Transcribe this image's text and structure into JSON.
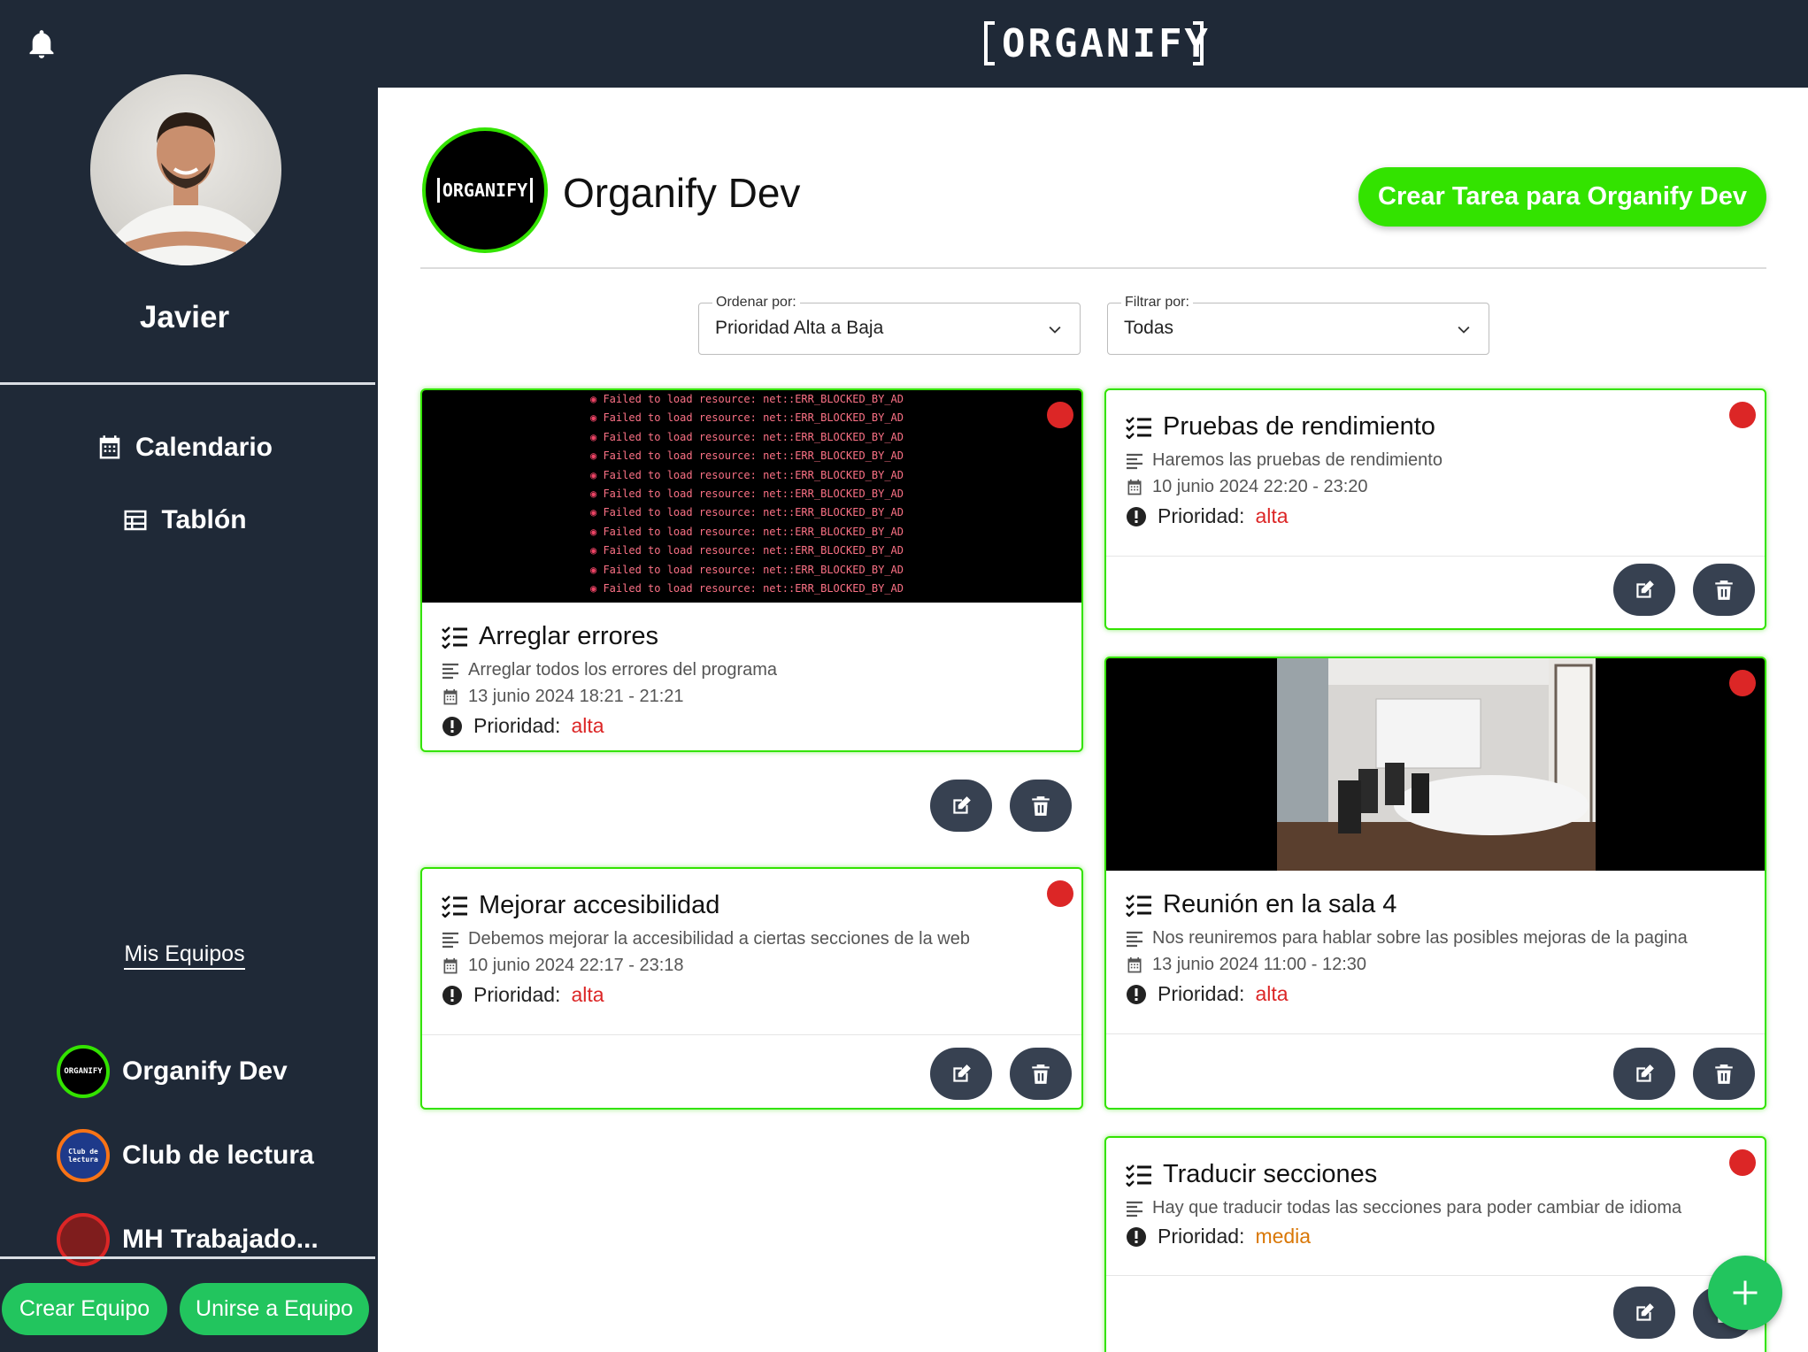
{
  "app": {
    "logo_text": "ORGANIFY"
  },
  "user": {
    "name": "Javier"
  },
  "nav": [
    {
      "label": "Calendario",
      "icon": "calendar-icon"
    },
    {
      "label": "Tablón",
      "icon": "table-icon"
    }
  ],
  "teams": {
    "title": "Mis Equipos",
    "items": [
      {
        "name": "Organify Dev",
        "badge": "ORGANIFY",
        "ring": "#33e300"
      },
      {
        "name": "Club de lectura",
        "badge": "Club de lectura",
        "ring": "#f97316"
      },
      {
        "name": "MH Trabajado...",
        "badge": "",
        "ring": "#dc2626"
      }
    ]
  },
  "sidebar_buttons": {
    "create": "Crear Equipo",
    "join": "Unirse a Equipo"
  },
  "page": {
    "team_logo": "ORGANIFY",
    "team_title": "Organify Dev",
    "create_task": "Crear Tarea para Organify Dev"
  },
  "sort": {
    "label": "Ordenar por:",
    "value": "Prioridad Alta a Baja"
  },
  "filter": {
    "label": "Filtrar por:",
    "value": "Todas"
  },
  "console_lines": [
    "Failed to load resource: net::ERR_BLOCKED_BY_AD",
    "Failed to load resource: net::ERR_BLOCKED_BY_AD",
    "Failed to load resource: net::ERR_BLOCKED_BY_AD",
    "Failed to load resource: net::ERR_BLOCKED_BY_AD",
    "Failed to load resource: net::ERR_BLOCKED_BY_AD",
    "Failed to load resource: net::ERR_BLOCKED_BY_AD",
    "Failed to load resource: net::ERR_BLOCKED_BY_AD",
    "Failed to load resource: net::ERR_BLOCKED_BY_AD",
    "Failed to load resource: net::ERR_BLOCKED_BY_AD",
    "Failed to load resource: net::ERR_BLOCKED_BY_AD",
    "Failed to load resource: net::ERR_BLOCKED_BY_AD"
  ],
  "tasks": [
    {
      "title": "Arreglar errores",
      "description": "Arreglar todos los errores del programa",
      "date": "13 junio 2024 18:21 - 21:21",
      "priority_label": "Prioridad:",
      "priority": "alta"
    },
    {
      "title": "Pruebas de rendimiento",
      "description": "Haremos las pruebas de rendimiento",
      "date": "10 junio 2024 22:20 - 23:20",
      "priority_label": "Prioridad:",
      "priority": "alta"
    },
    {
      "title": "Mejorar accesibilidad",
      "description": "Debemos mejorar la accesibilidad a ciertas secciones de la web",
      "date": "10 junio 2024 22:17 - 23:18",
      "priority_label": "Prioridad:",
      "priority": "alta"
    },
    {
      "title": "Reunión en la sala 4",
      "description": "Nos reuniremos para hablar sobre las posibles mejoras de la pagina",
      "date": "13 junio 2024 11:00 - 12:30",
      "priority_label": "Prioridad:",
      "priority": "alta"
    },
    {
      "title": "Traducir secciones",
      "description": "Hay que traducir todas las secciones para poder cambiar de idioma",
      "priority_label": "Prioridad:",
      "priority": "media"
    }
  ],
  "colors": {
    "accent": "#33e300",
    "sidebar": "#1f2937",
    "button": "#22c55e",
    "danger": "#dc2626",
    "warning": "#d97706"
  }
}
